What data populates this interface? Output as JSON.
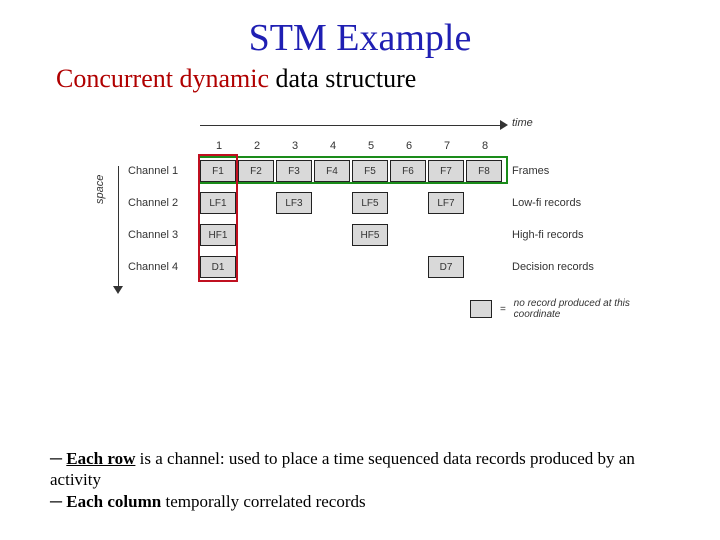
{
  "title": "STM Example",
  "subtitle": {
    "red": "Concurrent dynamic",
    "rest": " data structure"
  },
  "axes": {
    "time": "time",
    "space": "space"
  },
  "columns": [
    "1",
    "2",
    "3",
    "4",
    "5",
    "6",
    "7",
    "8"
  ],
  "rows": [
    {
      "label": "Channel 1",
      "cells": [
        "F1",
        "F2",
        "F3",
        "F4",
        "F5",
        "F6",
        "F7",
        "F8"
      ],
      "right": "Frames"
    },
    {
      "label": "Channel 2",
      "cells": [
        "LF1",
        "",
        "LF3",
        "",
        "LF5",
        "",
        "LF7",
        ""
      ],
      "right": "Low-fi records"
    },
    {
      "label": "Channel 3",
      "cells": [
        "HF1",
        "",
        "",
        "",
        "HF5",
        "",
        "",
        ""
      ],
      "right": "High-fi records"
    },
    {
      "label": "Channel 4",
      "cells": [
        "D1",
        "",
        "",
        "",
        "",
        "",
        "D7",
        ""
      ],
      "right": "Decision records"
    }
  ],
  "legend": {
    "eq": "=",
    "text": "no record produced at this coordinate"
  },
  "notes": {
    "l1_dash": "─ ",
    "l1_bold": "Each row",
    "l1_rest": " is a channel: used to place a time sequenced data records produced by an activity",
    "l2_dash": "─ ",
    "l2_bold": "Each column",
    "l2_rest": " temporally correlated records"
  }
}
